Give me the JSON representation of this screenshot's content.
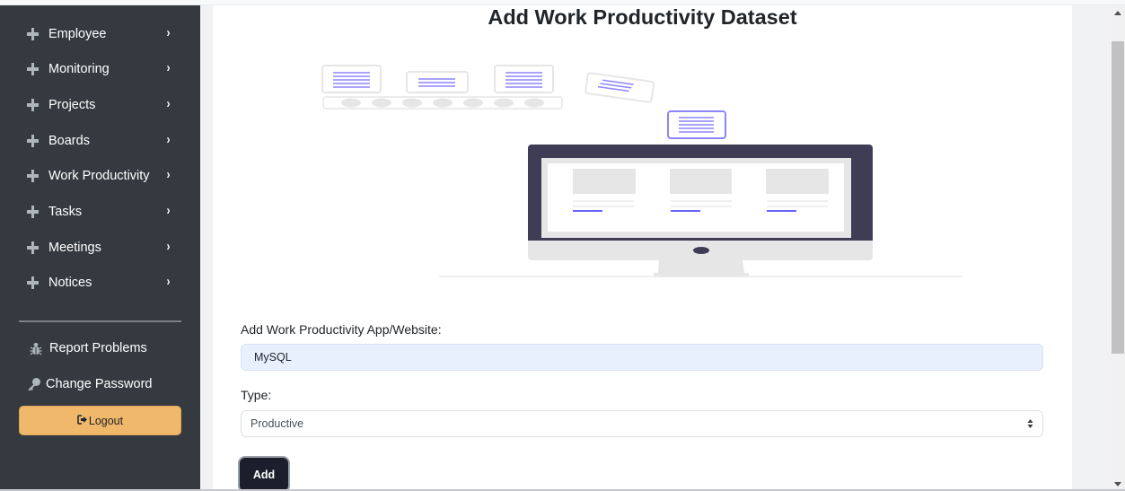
{
  "sidebar": {
    "nav_items": [
      {
        "label": "Employee",
        "icon": "plus-icon",
        "chevron": "›"
      },
      {
        "label": "Monitoring",
        "icon": "plus-icon",
        "chevron": "›"
      },
      {
        "label": "Projects",
        "icon": "plus-icon",
        "chevron": "›"
      },
      {
        "label": "Boards",
        "icon": "plus-icon",
        "chevron": "›"
      },
      {
        "label": "Work Productivity",
        "icon": "plus-icon",
        "chevron": "›"
      },
      {
        "label": "Tasks",
        "icon": "plus-icon",
        "chevron": "›"
      },
      {
        "label": "Meetings",
        "icon": "plus-icon",
        "chevron": "›"
      },
      {
        "label": "Notices",
        "icon": "plus-icon",
        "chevron": "›"
      }
    ],
    "report_problems": {
      "label": "Report Problems",
      "icon": "bug-icon"
    },
    "change_password": {
      "label": "Change Password",
      "icon": "key-icon"
    },
    "logout": {
      "label": "Logout",
      "icon": "sign-out-icon",
      "color": "#f0b86a"
    }
  },
  "main": {
    "title": "Add Work Productivity Dataset",
    "illustration": "computer-dashboard-illustration",
    "form": {
      "app_label": "Add Work Productivity App/Website:",
      "app_value": "MySQL",
      "type_label": "Type:",
      "type_value": "Productive",
      "add_label": "Add"
    }
  },
  "colors": {
    "sidebar_bg": "#343a40",
    "accent": "#6c63ff",
    "add_button": "#1a1f2b"
  }
}
